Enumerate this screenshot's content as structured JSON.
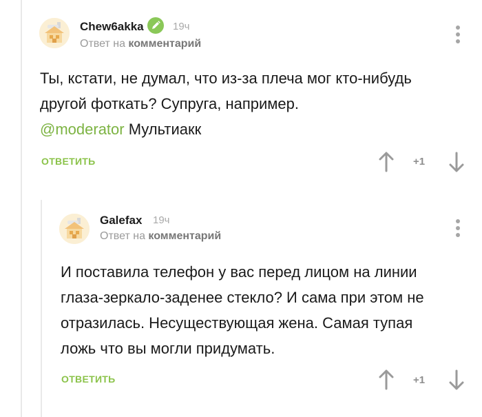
{
  "comments": [
    {
      "author": "Chew6akka",
      "time": "19ч",
      "reply_prefix": "Ответ на",
      "reply_link": "комментарий",
      "text_lines": [
        "Ты, кстати, не думал, что из-за плеча мог кто-нибудь",
        "другой фоткать? Супруга, например."
      ],
      "mention": "@moderator",
      "mention_suffix": " Мультиакк",
      "reply_label": "ОТВЕТИТЬ",
      "rating": "+1"
    },
    {
      "author": "Galefax",
      "time": "19ч",
      "reply_prefix": "Ответ на",
      "reply_link": "комментарий",
      "text_lines": [
        "И поставила телефон у вас перед лицом на линии",
        "глаза-зеркало-заденее стекло? И сама при этом не",
        "отразилась. Несуществующая жена. Самая тупая",
        "ложь что вы могли придумать."
      ],
      "reply_label": "ОТВЕТИТЬ",
      "rating": "+1"
    }
  ],
  "colors": {
    "accent": "#8bc34a",
    "mention": "#7cb342",
    "verified_badge": "#8ac858",
    "muted": "#a9a9a9",
    "thread_line": "#e9e9e9"
  },
  "icons": [
    "avatar-default",
    "verified-pencil-icon",
    "more-vertical-icon",
    "arrow-up-icon",
    "arrow-down-icon"
  ]
}
